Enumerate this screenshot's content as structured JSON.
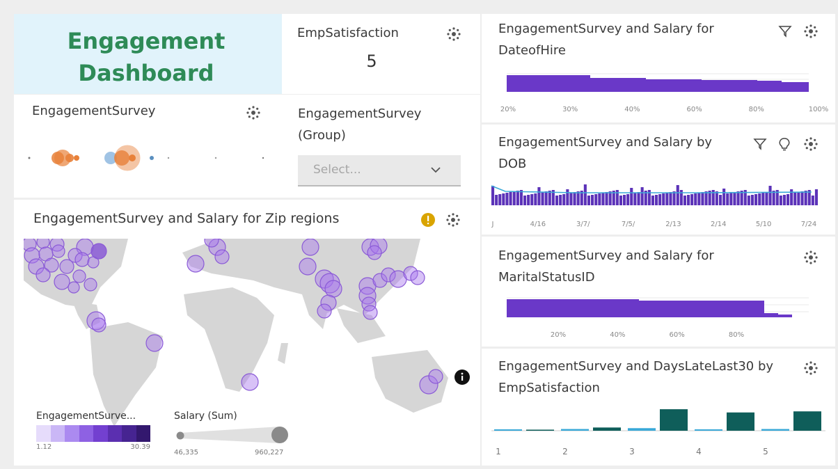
{
  "title_card": {
    "title": "Engagement Dashboard",
    "accent": "#2e8b57",
    "bg": "#e1f3fb"
  },
  "emp_satisfaction": {
    "title": "EmpSatisfaction",
    "value": "5"
  },
  "engagement_survey": {
    "title": "EngagementSurvey",
    "point_colors": [
      "#e8813a",
      "#8fb9df",
      "#9aa0a8"
    ]
  },
  "group_filter": {
    "title": "EngagementSurvey (Group)",
    "placeholder": "Select..."
  },
  "map_card": {
    "title": "EngagementSurvey and Salary for Zip regions",
    "info_icon": "info-icon",
    "legend_color": {
      "label": "EngagementSurve...",
      "min": "1.12",
      "max": "30.39",
      "swatches": [
        "#e6dcfb",
        "#cab7f6",
        "#ab8af0",
        "#8e61e3",
        "#7340d0",
        "#5b2fb0",
        "#462491",
        "#33186e"
      ]
    },
    "legend_size": {
      "label": "Salary (Sum)",
      "min": "46,335",
      "max": "960,227"
    },
    "bubble_color": "#a877ee"
  },
  "hire_chart": {
    "title": "EngagementSurvey and Salary for DateofHire",
    "ticks": [
      "20%",
      "30%",
      "40%",
      "60%",
      "80%",
      "100%"
    ],
    "bar_color": "#6a38c8"
  },
  "dob_chart": {
    "title": "EngagementSurvey and Salary by DOB",
    "ticks": [
      "J",
      "4/16",
      "3/7/",
      "7/5/",
      "2/13",
      "2/14",
      "5/10",
      "7/24"
    ],
    "bar_color": "#5b32b8",
    "line_color": "#3aa9d8"
  },
  "marital_chart": {
    "title": "EngagementSurvey and Salary for MaritalStatusID",
    "ticks": [
      "20%",
      "40%",
      "60%",
      "80%"
    ],
    "bar_color": "#6a38c8"
  },
  "days_late_chart": {
    "title": "EngagementSurvey and DaysLateLast30 by EmpSatisfaction",
    "bar_color": "#0f5e5a",
    "line_color": "#3aa9d8"
  },
  "chart_data": {
    "type": "bar",
    "title": "EngagementSurvey and DaysLateLast30 by EmpSatisfaction",
    "categories": [
      "1",
      "2",
      "3",
      "4",
      "5"
    ],
    "series": [
      {
        "name": "",
        "values": [
          0.05,
          0.15,
          1.0,
          0.85,
          0.9
        ]
      },
      {
        "name": "",
        "values": [
          0.02,
          0.08,
          0.12,
          0.05,
          0.08
        ]
      }
    ],
    "ylim": [
      0,
      1.1
    ]
  }
}
